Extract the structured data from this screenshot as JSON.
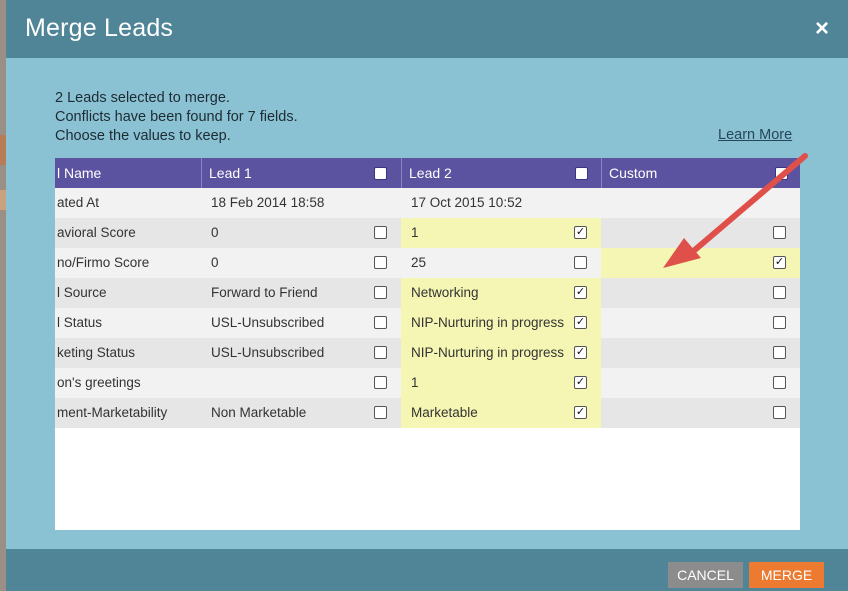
{
  "dialog": {
    "title": "Merge Leads",
    "close_icon": "×",
    "intro": [
      "2 Leads selected to merge.",
      "Conflicts have been found for 7 fields.",
      "Choose the values to keep."
    ],
    "learn_more": "Learn More"
  },
  "table": {
    "headers": {
      "field": "l Name",
      "lead1": "Lead 1",
      "lead2": "Lead 2",
      "custom": "Custom"
    },
    "rows": [
      {
        "field": "ated At",
        "lead1": "18 Feb 2014 18:58",
        "lead2": "17 Oct 2015 10:52",
        "custom": "",
        "has_checks": false,
        "lead1_checked": false,
        "lead2_checked": false,
        "custom_checked": false,
        "lead2_highlight": false,
        "custom_highlight": false
      },
      {
        "field": "avioral Score",
        "lead1": "0",
        "lead2": "1",
        "custom": "",
        "has_checks": true,
        "lead1_checked": false,
        "lead2_checked": true,
        "custom_checked": false,
        "lead2_highlight": true,
        "custom_highlight": false
      },
      {
        "field": "no/Firmo Score",
        "lead1": "0",
        "lead2": "25",
        "custom": "",
        "has_checks": true,
        "lead1_checked": false,
        "lead2_checked": false,
        "custom_checked": true,
        "lead2_highlight": false,
        "custom_highlight": true
      },
      {
        "field": "l Source",
        "lead1": "Forward to Friend",
        "lead2": "Networking",
        "custom": "",
        "has_checks": true,
        "lead1_checked": false,
        "lead2_checked": true,
        "custom_checked": false,
        "lead2_highlight": true,
        "custom_highlight": false
      },
      {
        "field": "l Status",
        "lead1": "USL-Unsubscribed",
        "lead2": "NIP-Nurturing in progress",
        "custom": "",
        "has_checks": true,
        "lead1_checked": false,
        "lead2_checked": true,
        "custom_checked": false,
        "lead2_highlight": true,
        "custom_highlight": false
      },
      {
        "field": "keting Status",
        "lead1": "USL-Unsubscribed",
        "lead2": "NIP-Nurturing in progress",
        "custom": "",
        "has_checks": true,
        "lead1_checked": false,
        "lead2_checked": true,
        "custom_checked": false,
        "lead2_highlight": true,
        "custom_highlight": false
      },
      {
        "field": "on's greetings",
        "lead1": "",
        "lead2": "1",
        "custom": "",
        "has_checks": true,
        "lead1_checked": false,
        "lead2_checked": true,
        "custom_checked": false,
        "lead2_highlight": true,
        "custom_highlight": false
      },
      {
        "field": "ment-Marketability",
        "lead1": "Non Marketable",
        "lead2": "Marketable",
        "custom": "",
        "has_checks": true,
        "lead1_checked": false,
        "lead2_checked": true,
        "custom_checked": false,
        "lead2_highlight": true,
        "custom_highlight": false
      }
    ]
  },
  "footer": {
    "cancel": "CANCEL",
    "merge": "MERGE"
  },
  "colors": {
    "titlebar": "#4f8597",
    "dialog_body": "#8bc2d3",
    "header": "#5b52a0",
    "highlight": "#f6f6b4",
    "merge_button": "#ec7a30",
    "cancel_button": "#8c8c8c",
    "annotation_arrow": "#e0504a"
  },
  "icons": {
    "close": "close-icon",
    "checkbox": "checkbox-icon",
    "annotation": "red-arrow-annotation"
  }
}
